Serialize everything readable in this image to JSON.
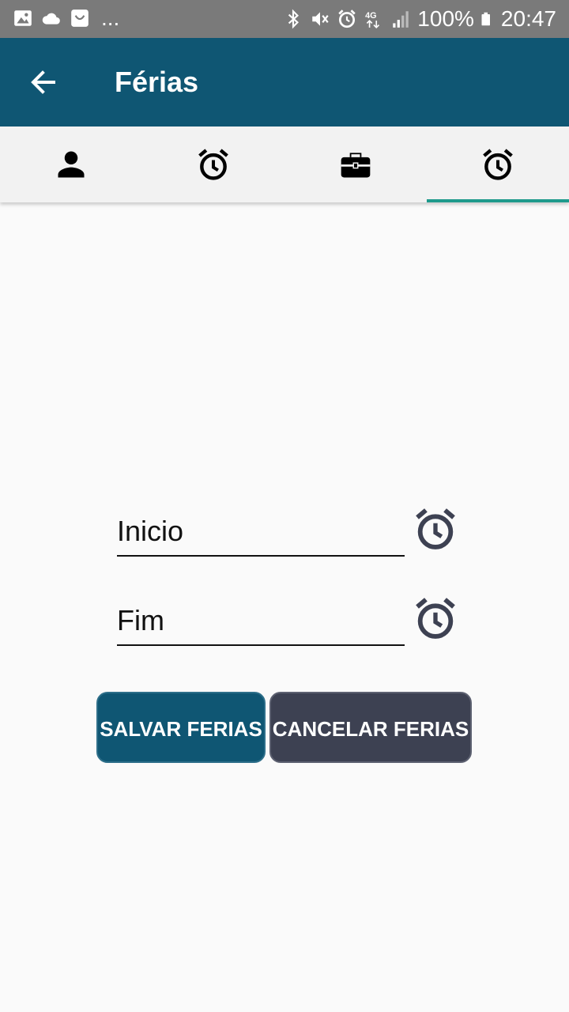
{
  "status_bar": {
    "left_icons": [
      "image-icon",
      "cloud-icon",
      "bag-icon"
    ],
    "overflow": "...",
    "right_icons": [
      "bluetooth-icon",
      "mute-icon",
      "alarm-icon",
      "network-4g-icon",
      "signal-icon"
    ],
    "battery": "100%",
    "time": "20:47"
  },
  "app_bar": {
    "back_icon": "arrow-back-icon",
    "title": "Férias",
    "background": "#0f5673"
  },
  "tabs": [
    {
      "icon": "person-icon",
      "selected": false
    },
    {
      "icon": "alarm-clock-icon",
      "selected": false
    },
    {
      "icon": "briefcase-icon",
      "selected": false
    },
    {
      "icon": "alarm-clock-icon",
      "selected": true
    }
  ],
  "tab_indicator_color": "#1e9a8c",
  "form": {
    "start": {
      "label": "Inicio",
      "icon": "alarm-clock-icon"
    },
    "end": {
      "label": "Fim",
      "icon": "alarm-clock-icon"
    }
  },
  "buttons": {
    "save_label": "SALVAR FERIAS",
    "save_color": "#0f5673",
    "cancel_label": "CANCELAR FERIAS",
    "cancel_color": "#3d4152"
  }
}
